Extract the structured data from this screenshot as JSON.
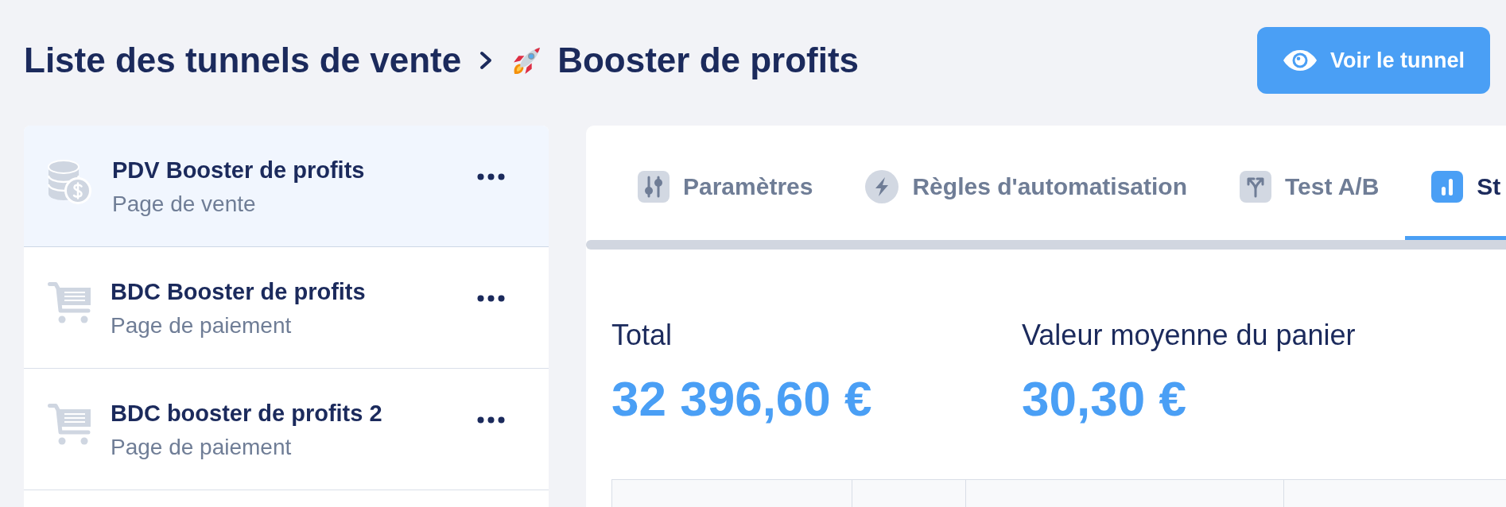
{
  "breadcrumb": {
    "parent": "Liste des tunnels de vente",
    "current": "Booster de profits"
  },
  "view_button": {
    "label": "Voir le tunnel"
  },
  "sidebar": {
    "items": [
      {
        "kind": "sales_page",
        "title": "PDV Booster de profits",
        "subtitle": "Page de vente",
        "selected": true
      },
      {
        "kind": "checkout_page",
        "title": "BDC Booster de profits",
        "subtitle": "Page de paiement",
        "selected": false
      },
      {
        "kind": "checkout_page",
        "title": "BDC booster de profits 2",
        "subtitle": "Page de paiement",
        "selected": false
      }
    ]
  },
  "tabs": [
    {
      "kind": "settings",
      "label": "Paramètres",
      "selected": false
    },
    {
      "kind": "automation",
      "label": "Règles d'automatisation",
      "selected": false
    },
    {
      "kind": "ab_test",
      "label": "Test A/B",
      "selected": false
    },
    {
      "kind": "statistics",
      "label": "St",
      "selected": true
    }
  ],
  "stats": [
    {
      "label": "Total",
      "value": "32 396,60 €"
    },
    {
      "label": "Valeur moyenne du panier",
      "value": "30,30 €"
    }
  ]
}
